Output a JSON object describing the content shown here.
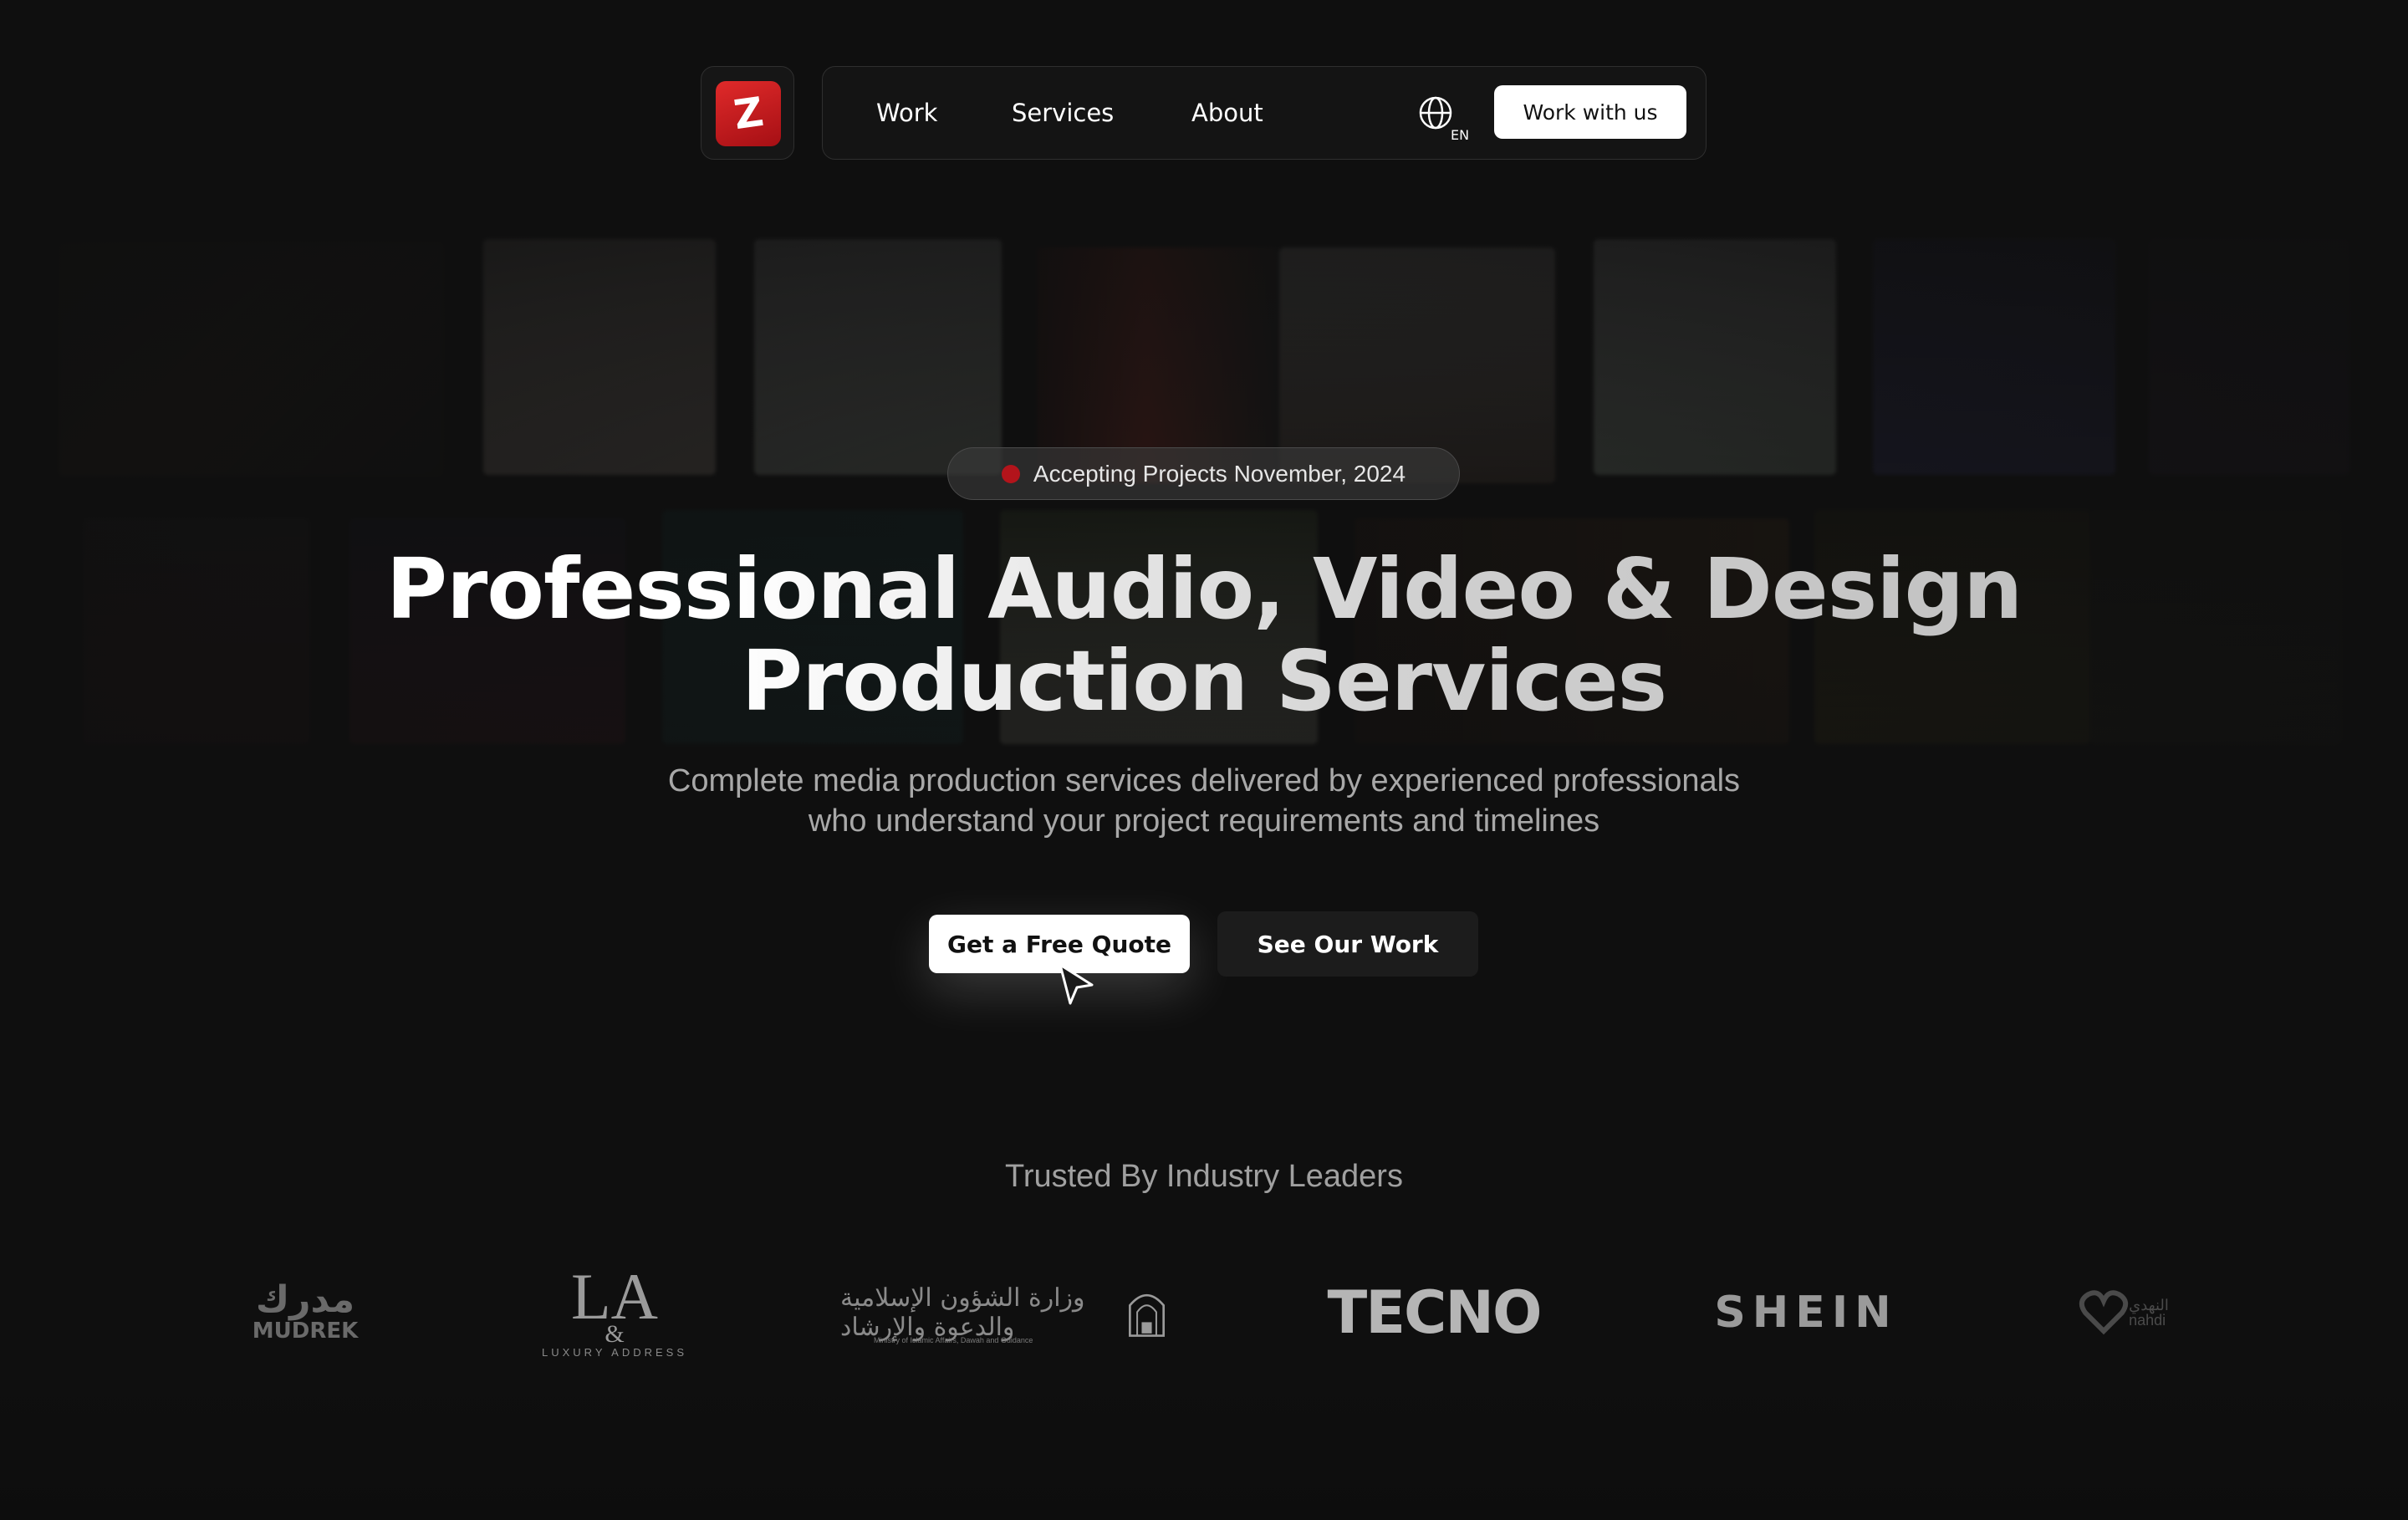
{
  "brand": {
    "logo_letter": "Z",
    "color": "#c8161d"
  },
  "nav": {
    "links": [
      "Work",
      "Services",
      "About"
    ],
    "language": "EN",
    "cta_label": "Work with us"
  },
  "hero": {
    "status_text": "Accepting Projects November, 2024",
    "status_color": "#b3141b",
    "title_line1": "Professional Audio, Video & Design",
    "title_line2": "Production Services",
    "subtitle_line1": "Complete media production services delivered by experienced professionals",
    "subtitle_line2": "who understand your project requirements and timelines",
    "primary_cta": "Get a Free Quote",
    "secondary_cta": "See Our Work"
  },
  "clients": {
    "heading": "Trusted By Industry Leaders",
    "logos": {
      "mudrek": {
        "arabic": "مدرك",
        "latin": "MUDREK"
      },
      "luxury_address": {
        "mark": "LA",
        "amp": "&",
        "caption": "LUXURY ADDRESS"
      },
      "ministry": {
        "arabic": "وزارة الشؤون الإسلامية والدعوة والإرشاد",
        "english": "Ministry of Islamic Affairs, Dawah and Guidance"
      },
      "tecno": "TECNO",
      "shein": "SHEIN",
      "nahdi": {
        "arabic": "النهدي",
        "latin": "nahdi"
      }
    }
  }
}
